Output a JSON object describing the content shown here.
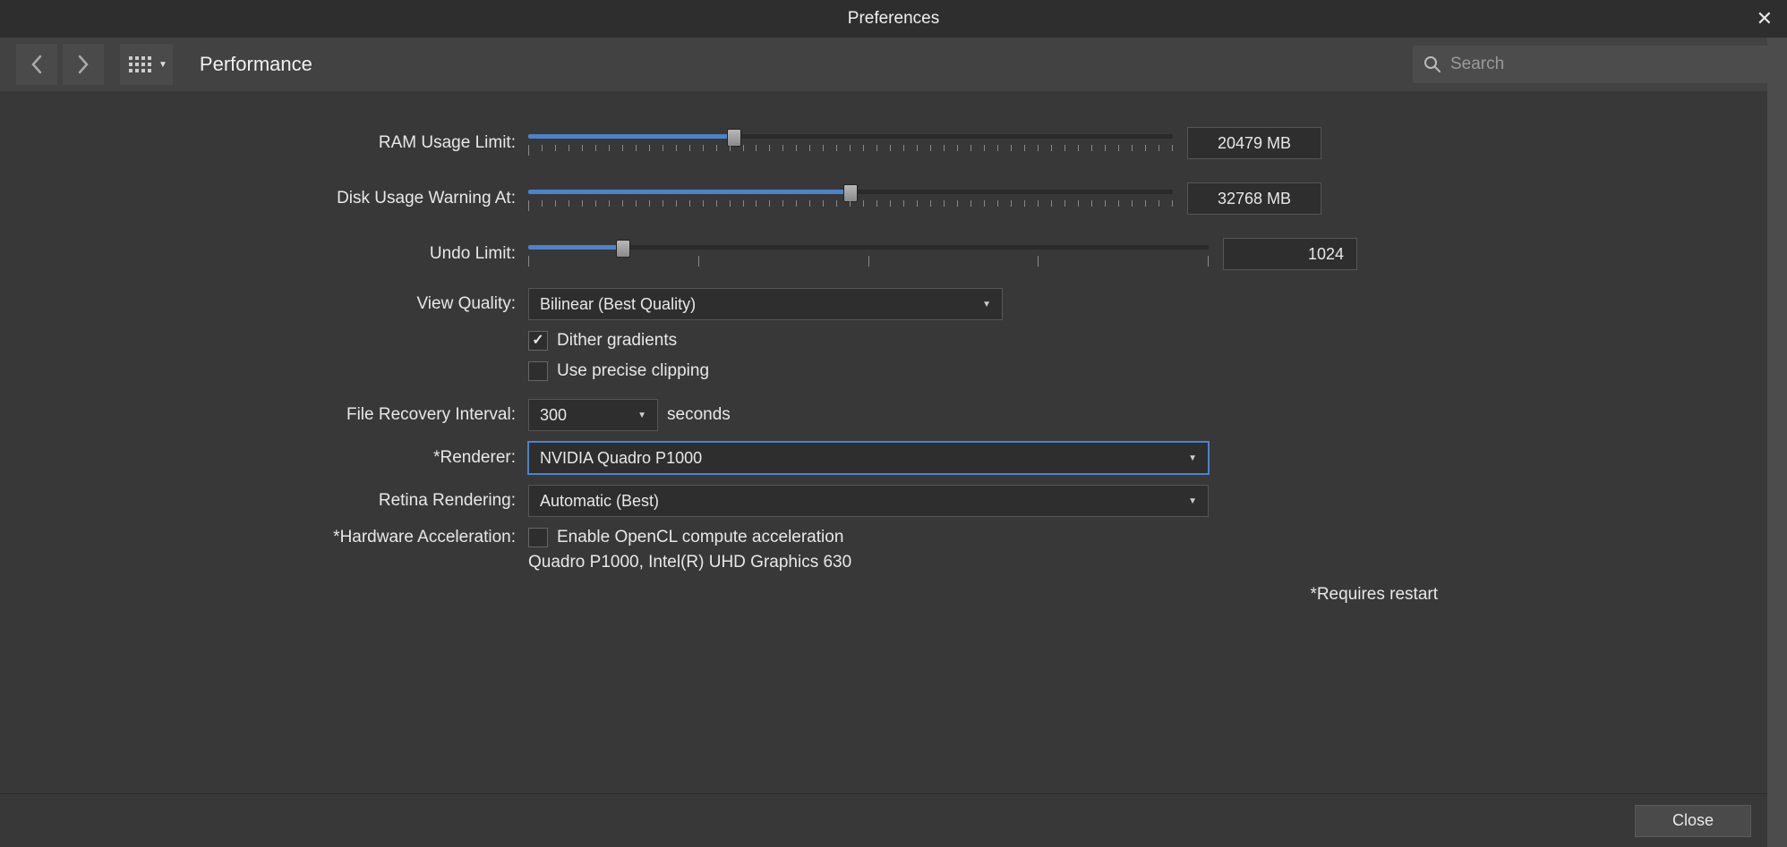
{
  "window": {
    "title": "Preferences"
  },
  "toolbar": {
    "page_title": "Performance",
    "search_placeholder": "Search"
  },
  "settings": {
    "ram_limit": {
      "label": "RAM Usage Limit:",
      "value": "20479 MB",
      "fill_pct": 32
    },
    "disk_warning": {
      "label": "Disk Usage Warning At:",
      "value": "32768 MB",
      "fill_pct": 50
    },
    "undo_limit": {
      "label": "Undo Limit:",
      "value": "1024",
      "fill_pct": 14
    },
    "view_quality": {
      "label": "View Quality:",
      "value": "Bilinear (Best Quality)"
    },
    "dither": {
      "label": "Dither gradients",
      "checked": true
    },
    "precise_clipping": {
      "label": "Use precise clipping",
      "checked": false
    },
    "file_recovery": {
      "label": "File Recovery Interval:",
      "value": "300",
      "unit": "seconds"
    },
    "renderer": {
      "label": "*Renderer:",
      "value": "NVIDIA Quadro P1000"
    },
    "retina": {
      "label": "Retina Rendering:",
      "value": "Automatic (Best)"
    },
    "hw_accel": {
      "label": "*Hardware Acceleration:",
      "checkbox_label": "Enable OpenCL compute acceleration",
      "checked": false,
      "devices": "Quadro P1000, Intel(R) UHD Graphics 630"
    },
    "footnote": "*Requires restart"
  },
  "footer": {
    "close": "Close"
  }
}
